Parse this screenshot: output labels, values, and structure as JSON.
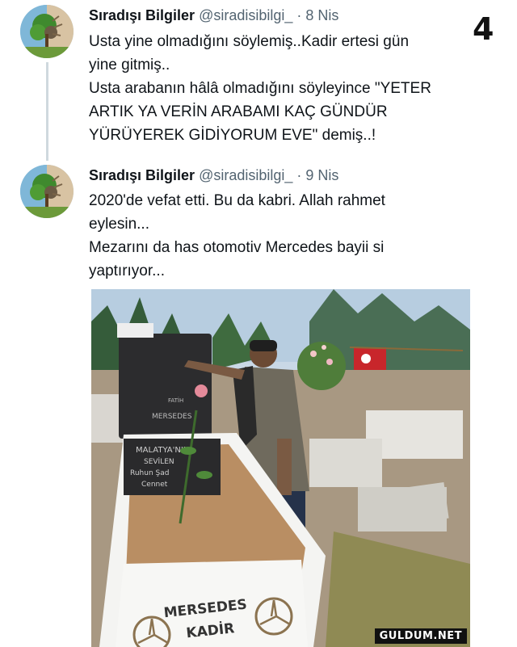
{
  "page_index": "4",
  "tweets": [
    {
      "author": "Sıradışı Bilgiler",
      "handle": "@siradisibilgi_",
      "separator": "·",
      "date": "8 Nis",
      "lines": [
        "Usta yine olmadığını söylemiş..Kadir ertesi gün",
        "yine gitmiş..",
        "Usta arabanın hâlâ olmadığını söyleyince \"YETER",
        "ARTIK YA VERİN ARABAMI KAÇ GÜNDÜR",
        "YÜRÜYEREK GİDİYORUM EVE\" demiş..!"
      ]
    },
    {
      "author": "Sıradışı Bilgiler",
      "handle": "@siradisibilgi_",
      "separator": "·",
      "date": "9 Nis",
      "lines": [
        "2020'de vefat etti. Bu da kabri. Allah rahmet",
        "eylesin...",
        "Mezarını da has otomotiv Mercedes bayii si",
        "yaptırıyor..."
      ]
    }
  ],
  "photo": {
    "headstone_lines": [
      "MERSEDES",
      "FATİH"
    ],
    "plaque_lines": [
      "MALATYA'NIN",
      "SEVİLEN",
      "Ruhun Şad",
      "Cennet"
    ],
    "grave_text_lines": [
      "MERSEDES",
      "KADİR"
    ]
  },
  "watermark": "GULDUM.NET",
  "colors": {
    "text": "#0f1419",
    "secondary": "#536471",
    "thread_line": "#cfd9de"
  }
}
